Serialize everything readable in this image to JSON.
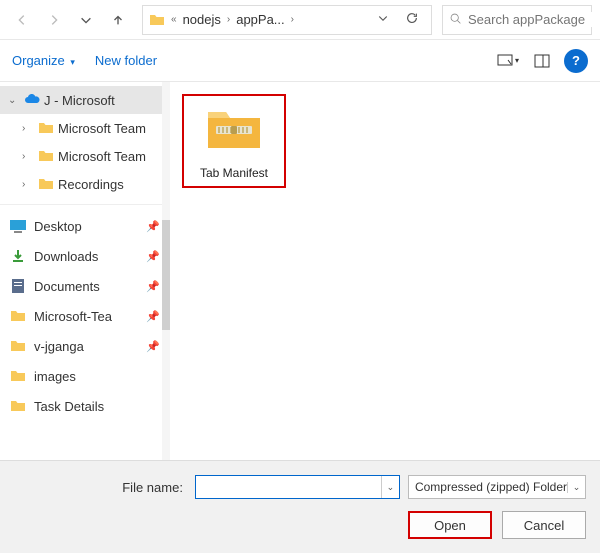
{
  "toolbar": {
    "breadcrumb": [
      "nodejs",
      "appPa..."
    ],
    "search_placeholder": "Search appPackage"
  },
  "cmdbar": {
    "organize": "Organize",
    "new_folder": "New folder"
  },
  "tree": {
    "root": "J - Microsoft",
    "children": [
      "Microsoft Team",
      "Microsoft Team",
      "Recordings"
    ]
  },
  "quick": [
    {
      "label": "Desktop",
      "kind": "desktop"
    },
    {
      "label": "Downloads",
      "kind": "downloads"
    },
    {
      "label": "Documents",
      "kind": "documents"
    },
    {
      "label": "Microsoft-Tea",
      "kind": "folder"
    },
    {
      "label": "v-jganga",
      "kind": "folder"
    },
    {
      "label": "images",
      "kind": "folder"
    },
    {
      "label": "Task Details",
      "kind": "folder"
    }
  ],
  "content": {
    "file": "Tab Manifest"
  },
  "footer": {
    "label": "File name:",
    "filename": "",
    "filter": "Compressed (zipped) Folder",
    "open": "Open",
    "cancel": "Cancel"
  }
}
